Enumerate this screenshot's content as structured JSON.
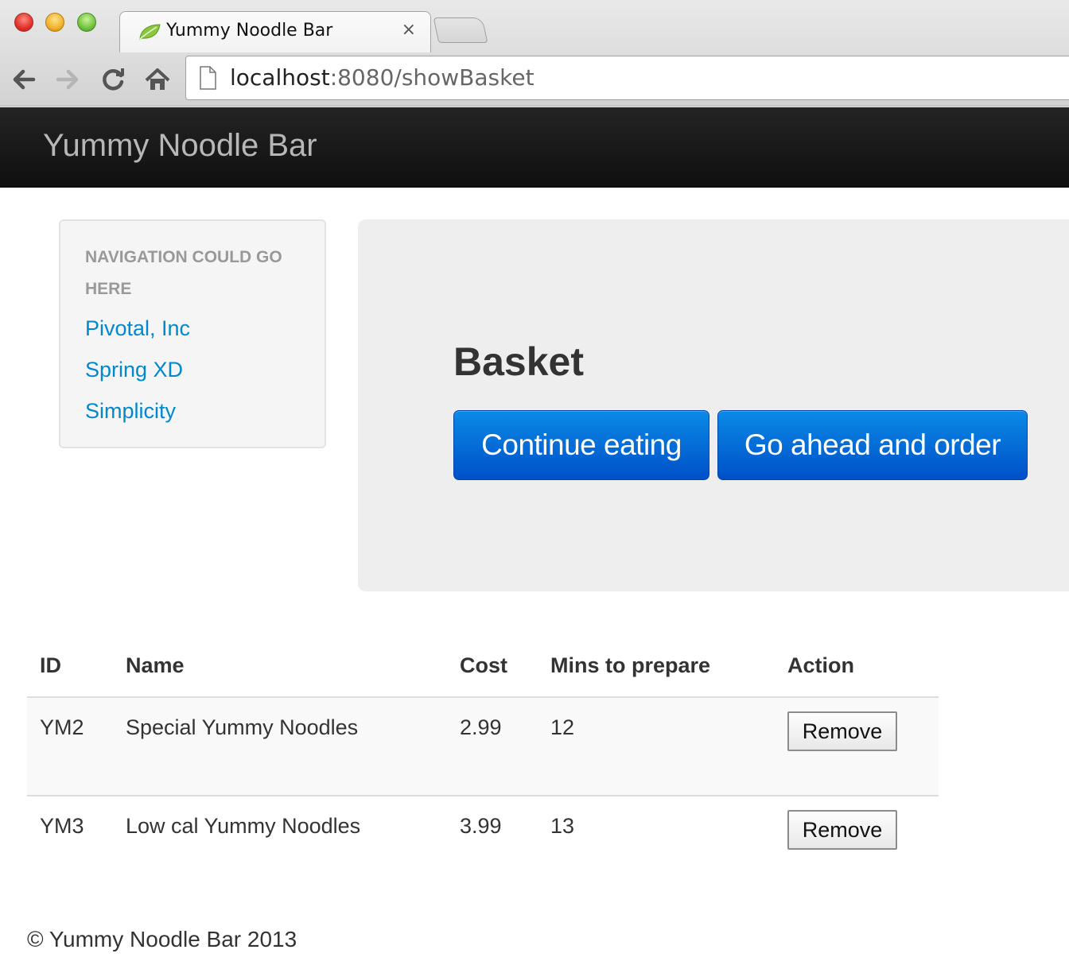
{
  "browser": {
    "tab_title": "Yummy Noodle Bar",
    "tab_close": "×",
    "url_host": "localhost",
    "url_rest": ":8080/showBasket"
  },
  "navbar": {
    "brand": "Yummy Noodle Bar"
  },
  "sidebar": {
    "header": "NAVIGATION COULD GO HERE",
    "links": [
      "Pivotal, Inc",
      "Spring XD",
      "Simplicity"
    ]
  },
  "hero": {
    "title": "Basket",
    "continue_label": "Continue eating",
    "order_label": "Go ahead and order"
  },
  "table": {
    "headers": [
      "ID",
      "Name",
      "Cost",
      "Mins to prepare",
      "Action"
    ],
    "rows": [
      {
        "id": "YM2",
        "name": "Special Yummy Noodles",
        "cost": "2.99",
        "mins": "12",
        "action": "Remove"
      },
      {
        "id": "YM3",
        "name": "Low cal Yummy Noodles",
        "cost": "3.99",
        "mins": "13",
        "action": "Remove"
      }
    ]
  },
  "footer": {
    "text": "© Yummy Noodle Bar 2013"
  },
  "colors": {
    "link": "#0088cc",
    "primary_button": "#0050c8",
    "navbar": "#1b1b1b"
  }
}
